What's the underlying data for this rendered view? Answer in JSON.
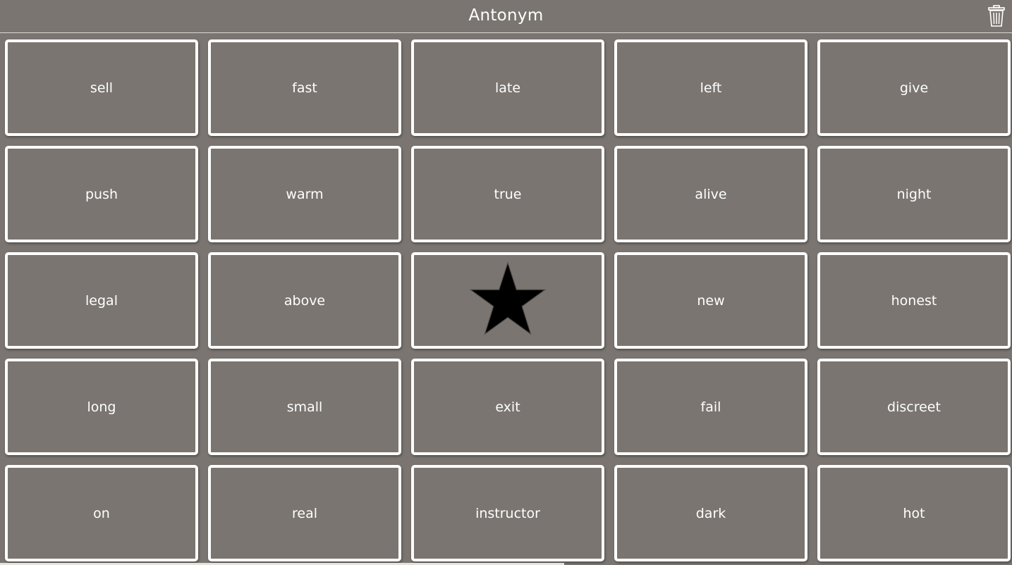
{
  "header": {
    "title": "Antonym",
    "trash_icon": "trash-can-icon"
  },
  "board": {
    "free_space_icon": "star-icon",
    "cells": [
      {
        "word": "sell"
      },
      {
        "word": "fast"
      },
      {
        "word": "late"
      },
      {
        "word": "left"
      },
      {
        "word": "give"
      },
      {
        "word": "push"
      },
      {
        "word": "warm"
      },
      {
        "word": "true"
      },
      {
        "word": "alive"
      },
      {
        "word": "night"
      },
      {
        "word": "legal"
      },
      {
        "word": "above"
      },
      {
        "word": ""
      },
      {
        "word": "new"
      },
      {
        "word": "honest"
      },
      {
        "word": "long"
      },
      {
        "word": "small"
      },
      {
        "word": "exit"
      },
      {
        "word": "fail"
      },
      {
        "word": "discreet"
      },
      {
        "word": "on"
      },
      {
        "word": "real"
      },
      {
        "word": "instructor"
      },
      {
        "word": "dark"
      },
      {
        "word": "hot"
      }
    ]
  },
  "colors": {
    "background": "#7a7570",
    "cell_border": "#ffffff",
    "text": "#ffffff",
    "star": "#000000"
  }
}
